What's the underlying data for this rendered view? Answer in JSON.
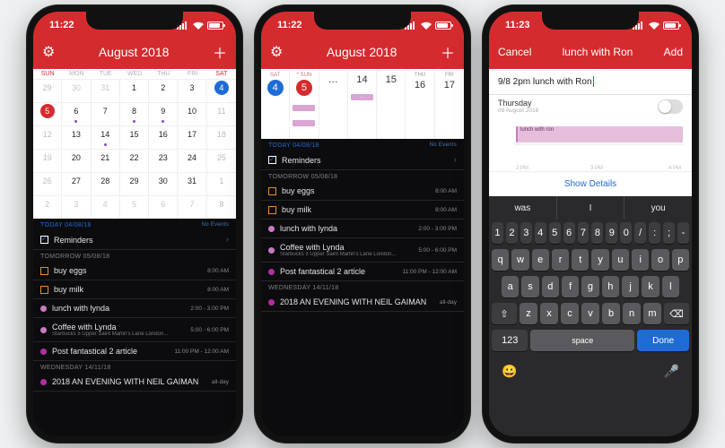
{
  "phone1": {
    "status_time": "11:22",
    "header_title": "August 2018",
    "dow": [
      "SUN",
      "MON",
      "TUE",
      "WED",
      "THU",
      "FRI",
      "SAT"
    ],
    "calendar_cells": [
      [
        29,
        1
      ],
      [
        30,
        1
      ],
      [
        31,
        1
      ],
      [
        1,
        0
      ],
      [
        2,
        0
      ],
      [
        3,
        0
      ],
      [
        4,
        0,
        "sel"
      ],
      [
        5,
        0,
        "today"
      ],
      [
        6,
        0,
        "ev"
      ],
      [
        7,
        0
      ],
      [
        8,
        0,
        "ev"
      ],
      [
        9,
        0,
        "ev"
      ],
      [
        10,
        0
      ],
      [
        11,
        0
      ],
      [
        12,
        0
      ],
      [
        13,
        0
      ],
      [
        14,
        0,
        "ev"
      ],
      [
        15,
        0
      ],
      [
        16,
        0
      ],
      [
        17,
        0
      ],
      [
        18,
        0
      ],
      [
        19,
        0
      ],
      [
        20,
        0
      ],
      [
        21,
        0
      ],
      [
        22,
        0
      ],
      [
        23,
        0
      ],
      [
        24,
        0
      ],
      [
        25,
        0
      ],
      [
        26,
        0
      ],
      [
        27,
        0
      ],
      [
        28,
        0
      ],
      [
        29,
        0
      ],
      [
        30,
        0
      ],
      [
        31,
        0
      ],
      [
        1,
        1
      ],
      [
        2,
        1
      ],
      [
        3,
        1
      ],
      [
        4,
        1
      ],
      [
        5,
        1
      ],
      [
        6,
        1
      ],
      [
        7,
        1
      ],
      [
        8,
        1
      ]
    ],
    "sections": [
      {
        "label": "TODAY 04/08/18",
        "today": true,
        "noev": "No Events",
        "items": [
          {
            "type": "rem",
            "done": true,
            "title": "Reminders",
            "chev": true
          }
        ]
      },
      {
        "label": "TOMORROW 05/08/18",
        "items": [
          {
            "type": "chk",
            "color": "orange",
            "title": "buy eggs",
            "time": "8:00 AM"
          },
          {
            "type": "chk",
            "color": "orange",
            "title": "buy milk",
            "time": "8:00 AM"
          },
          {
            "type": "ev",
            "color": "#c97ac2",
            "title": "lunch with lynda",
            "time": "2:00 - 3:00 PM"
          },
          {
            "type": "ev",
            "color": "#c97ac2",
            "title": "Coffee with Lynda",
            "sub": "Starbucks 5 Upper Saint Martin's Lane London...",
            "time": "5:00 - 6:00 PM"
          },
          {
            "type": "ev",
            "color": "#b22fa0",
            "title": "Post fantastical 2 article",
            "time": "11:00 PM - 12:00 AM"
          }
        ]
      },
      {
        "label": "WEDNESDAY 14/11/18",
        "items": [
          {
            "type": "ev",
            "color": "#b22fa0",
            "title": "2018 AN EVENING WITH NEIL GAIMAN",
            "time": "all-day"
          }
        ]
      }
    ]
  },
  "phone2": {
    "status_time": "11:22",
    "header_title": "August 2018",
    "week": [
      {
        "dow": "SAT",
        "n": 4,
        "sel": true,
        "wkend": true
      },
      {
        "dow": "* SUN",
        "n": 5,
        "today": true,
        "wkend": true,
        "ev": [
          {
            "c": "#d9a5d3"
          },
          {
            "c": "#d9a5d3"
          }
        ]
      },
      {
        "dow": "",
        "n": "…",
        "faded": true
      },
      {
        "dow": "",
        "n": 14,
        "ev": [
          {
            "c": "#d9a5d3",
            "label": "..."
          }
        ]
      },
      {
        "dow": "",
        "n": 15
      },
      {
        "dow": "THU",
        "n": 16
      },
      {
        "dow": "FRI",
        "n": 17
      }
    ],
    "sections": [
      {
        "label": "TODAY 04/08/18",
        "today": true,
        "noev": "No Events",
        "items": [
          {
            "type": "rem",
            "done": true,
            "title": "Reminders",
            "chev": true
          }
        ]
      },
      {
        "label": "TOMORROW 05/08/18",
        "items": [
          {
            "type": "chk",
            "color": "orange",
            "title": "buy eggs",
            "time": "8:00 AM"
          },
          {
            "type": "chk",
            "color": "orange",
            "title": "buy milk",
            "time": "8:00 AM"
          },
          {
            "type": "ev",
            "color": "#c97ac2",
            "title": "lunch with lynda",
            "time": "2:00 - 3:00 PM"
          },
          {
            "type": "ev",
            "color": "#c97ac2",
            "title": "Coffee with Lynda",
            "sub": "Starbucks 5 Upper Saint Martin's Lane London...",
            "time": "5:00 - 6:00 PM"
          },
          {
            "type": "ev",
            "color": "#b22fa0",
            "title": "Post fantastical 2 article",
            "time": "11:00 PM - 12:00 AM"
          }
        ]
      },
      {
        "label": "WEDNESDAY 14/11/18",
        "items": [
          {
            "type": "ev",
            "color": "#b22fa0",
            "title": "2018 AN EVENING WITH NEIL GAIMAN",
            "time": "all-day"
          }
        ]
      }
    ]
  },
  "phone3": {
    "status_time": "11:23",
    "cancel": "Cancel",
    "title": "lunch with Ron",
    "add": "Add",
    "input_text": "9/8 2pm lunch with Ron",
    "day_name": "Thursday",
    "day_date": "09 August 2018",
    "event_block": "lunch with ron",
    "hours": [
      "2 PM",
      "3 PM",
      "4 PM"
    ],
    "show_details": "Show Details",
    "suggestions": [
      "was",
      "I",
      "you"
    ],
    "num_keys": [
      "1",
      "2",
      "3",
      "4",
      "5",
      "6",
      "7",
      "8",
      "9",
      "0",
      "/",
      ":",
      ";",
      "-"
    ],
    "row_q": [
      "q",
      "w",
      "e",
      "r",
      "t",
      "y",
      "u",
      "i",
      "o",
      "p"
    ],
    "row_a": [
      "a",
      "s",
      "d",
      "f",
      "g",
      "h",
      "j",
      "k",
      "l"
    ],
    "row_z": [
      "z",
      "x",
      "c",
      "v",
      "b",
      "n",
      "m"
    ],
    "shift": "⇧",
    "bksp": "⌫",
    "mode": "123",
    "space": "space",
    "done": "Done",
    "emoji": "😀",
    "mic": "🎤"
  }
}
